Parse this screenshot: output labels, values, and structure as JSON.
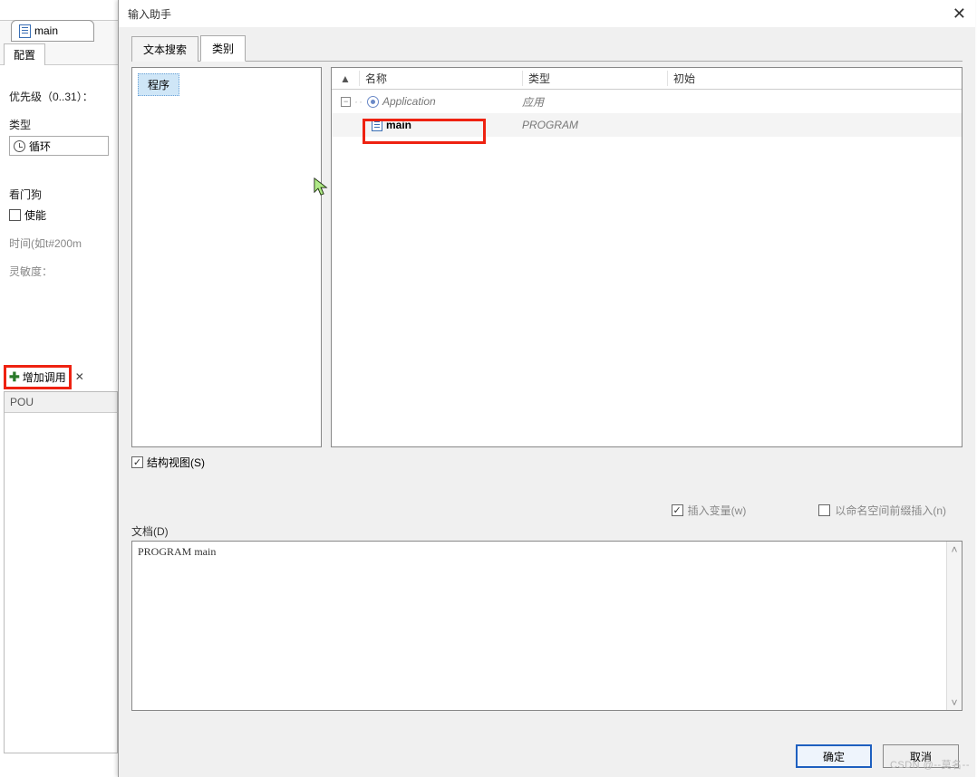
{
  "bg": {
    "tab_main": "main",
    "sub_tab": "配置",
    "priority_label": "优先级（0..31）：",
    "type_label": "类型",
    "type_value": "循环",
    "watchdog_label": "看门狗",
    "enable_label": "使能",
    "time_label": "时间(如t#200m",
    "sensitivity_label": "灵敏度：",
    "add_call_label": "增加调用",
    "grid_header": "POU"
  },
  "dialog": {
    "title": "输入助手",
    "tabs": {
      "text_search": "文本搜索",
      "category": "类别"
    },
    "left_item": "程序",
    "columns": {
      "name": "名称",
      "type": "类型",
      "initial": "初始"
    },
    "rows": {
      "app": {
        "name": "Application",
        "type": "应用"
      },
      "main": {
        "name": "main",
        "type": "PROGRAM"
      }
    },
    "struct_view": "结构视图(S)",
    "insert_var": "插入变量(w)",
    "ns_prefix": "以命名空间前缀插入(n)",
    "doc_label": "文档(D)",
    "doc_text": "PROGRAM main",
    "btn_ok": "确定",
    "btn_cancel": "取消"
  },
  "watermark": "CSDN @--莫名--"
}
